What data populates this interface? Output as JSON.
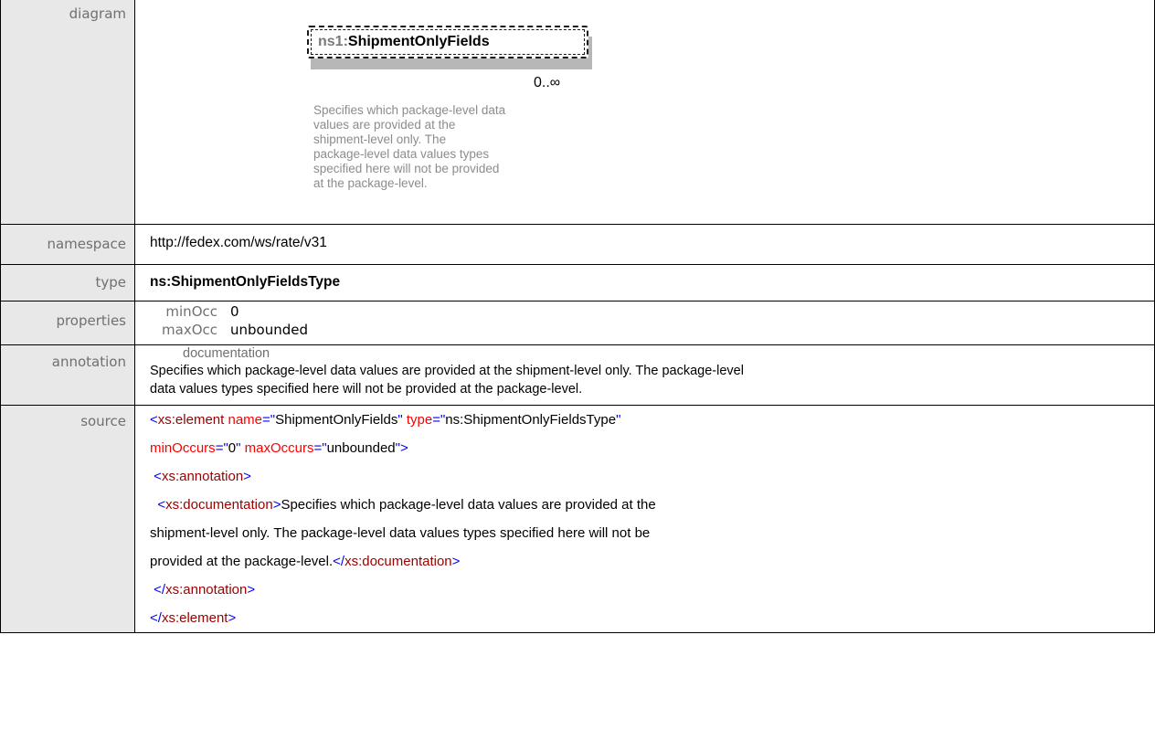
{
  "rows": {
    "diagram": {
      "label": "diagram",
      "element_prefix": "ns1:",
      "element_name": "ShipmentOnlyFields",
      "multiplicity": "0..∞",
      "doc_lines": [
        "Specifies which package-level data",
        "values are provided at the",
        "shipment-level only. The",
        "package-level data values types",
        "specified here will not be provided",
        "at the package-level."
      ]
    },
    "namespace": {
      "label": "namespace",
      "value": "http://fedex.com/ws/rate/v31"
    },
    "type": {
      "label": "type",
      "value": "ns:ShipmentOnlyFieldsType"
    },
    "properties": {
      "label": "properties",
      "min_key": "minOcc",
      "min_value": "0",
      "max_key": "maxOcc",
      "max_value": "unbounded"
    },
    "annotation": {
      "label": "annotation",
      "title": "documentation",
      "text_line1": "Specifies which package-level data values are provided at the shipment-level only. The package-level",
      "text_line2": "data values types specified here will not be provided at the package-level."
    },
    "source": {
      "label": "source",
      "l1_open": "<xs:element ",
      "l1_attr1": "name",
      "l1_eq1": "=\"",
      "l1_val1": "ShipmentOnlyFields",
      "l1_q1": "\" ",
      "l1_attr2": "type",
      "l1_eq2": "=\"",
      "l1_val2": "ns:ShipmentOnlyFieldsType",
      "l1_q2": "\"",
      "l2_attr1": "minOccurs",
      "l2_eq1": "=\"",
      "l2_val1": "0",
      "l2_q1": "\" ",
      "l2_attr2": "maxOccurs",
      "l2_eq2": "=\"",
      "l2_val2": "unbounded",
      "l2_close": "\">",
      "l3_lt": "<",
      "l3_tag": "xs:annotation",
      "l3_gt": ">",
      "l4_lt": "<",
      "l4_tag": "xs:documentation",
      "l4_gt": ">",
      "l4_text": "Specifies which package-level data values are provided at the",
      "l5_text": "shipment-level only. The package-level data values types specified here will not be",
      "l6_text": "provided at the package-level.",
      "l6_lt": "</",
      "l6_tag": "xs:documentation",
      "l6_gt": ">",
      "l7_lt": "</",
      "l7_tag": "xs:annotation",
      "l7_gt": ">",
      "l8_lt": "</",
      "l8_tag": "xs:element",
      "l8_gt": ">"
    }
  },
  "colors": {
    "label_bg": "#e8e8e8",
    "markup_blue": "#0000ff",
    "tag_red": "#990000",
    "attr_red": "#ff0000"
  }
}
